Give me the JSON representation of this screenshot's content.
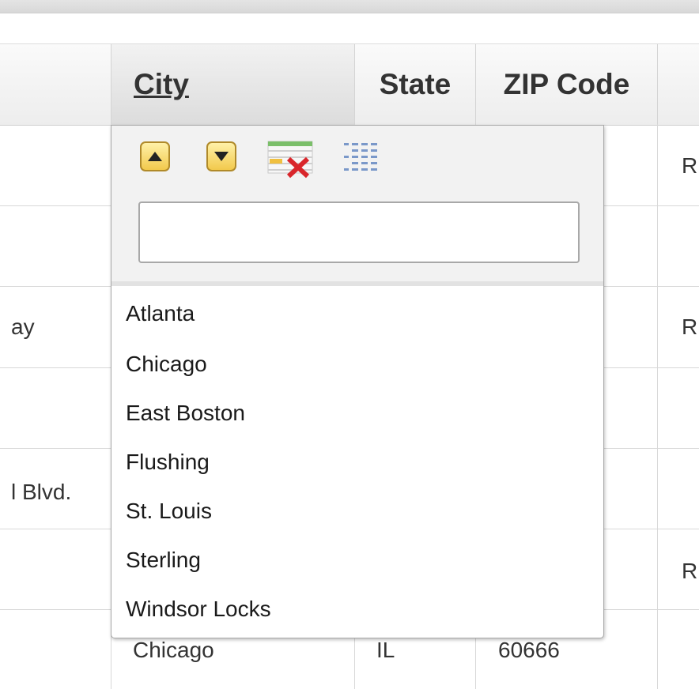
{
  "header": {
    "city": "City",
    "state": "State",
    "zip": "ZIP Code"
  },
  "rows": {
    "r1_right": "R",
    "r3_left": "ay",
    "r3_right": "R",
    "r5_left": "l Blvd.",
    "r6_right": "R",
    "last_city": "Chicago",
    "last_state": "IL",
    "last_zip": "60666"
  },
  "filter": {
    "sort_ascending_icon": "sort-ascending-icon",
    "sort_descending_icon": "sort-descending-icon",
    "clear_filter_icon": "clear-filter-icon",
    "column_chooser_icon": "column-chooser-icon",
    "search_value": "",
    "options": [
      "Atlanta",
      "Chicago",
      "East Boston",
      "Flushing",
      "St. Louis",
      "Sterling",
      "Windsor Locks"
    ]
  },
  "colors": {
    "sort_button_fill": "#f2c94c",
    "clear_x": "#d9262b",
    "grid_line": "#d8d8d8"
  }
}
